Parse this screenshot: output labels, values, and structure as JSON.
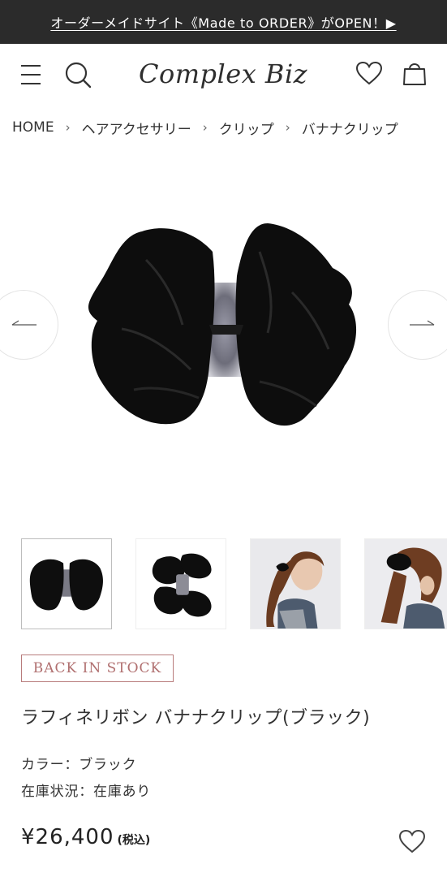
{
  "banner": {
    "text": "オーダーメイドサイト《Made to ORDER》がOPEN！▶"
  },
  "header": {
    "logo": "Complex Biz",
    "icons": {
      "menu": "hamburger-menu-icon",
      "search": "search-icon",
      "favorite": "heart-icon",
      "cart": "shopping-bag-icon"
    }
  },
  "breadcrumb": {
    "items": [
      "HOME",
      "ヘアアクセサリー",
      "クリップ",
      "バナナクリップ"
    ],
    "separator": "›"
  },
  "gallery": {
    "prev_icon": "arrow-left-icon",
    "next_icon": "arrow-right-icon"
  },
  "product": {
    "badge": "BACK IN STOCK",
    "title": "ラフィネリボン バナナクリップ(ブラック)",
    "color_line": "カラー：ブラック",
    "stock_line": "在庫状況：在庫あり",
    "price": "¥26,400",
    "tax_note": "(税込)"
  },
  "colors": {
    "banner_bg": "#2b2b2b",
    "badge_accent": "#b06f6f",
    "text": "#333333"
  }
}
